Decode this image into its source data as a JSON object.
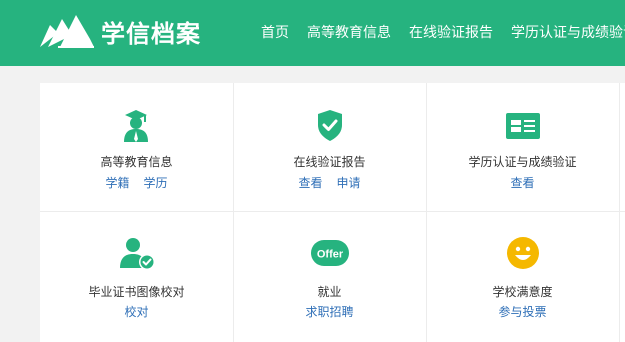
{
  "header": {
    "logo_text": "学信档案",
    "nav": [
      "首页",
      "高等教育信息",
      "在线验证报告",
      "学历认证与成绩验证"
    ]
  },
  "colors": {
    "brand_green": "#26b37f",
    "link_blue": "#2f6fb7",
    "smile_yellow": "#f5b800"
  },
  "services": [
    {
      "title": "高等教育信息",
      "icon": "graduate-icon",
      "links": [
        "学籍",
        "学历"
      ]
    },
    {
      "title": "在线验证报告",
      "icon": "shield-check-icon",
      "links": [
        "查看",
        "申请"
      ]
    },
    {
      "title": "学历认证与成绩验证",
      "icon": "id-card-icon",
      "links": [
        "查看"
      ]
    },
    {
      "title": "毕业证书图像校对",
      "icon": "user-check-icon",
      "links": [
        "校对"
      ]
    },
    {
      "title": "就业",
      "icon": "offer-icon",
      "icon_text": "Offer",
      "links": [
        "求职招聘"
      ]
    },
    {
      "title": "学校满意度",
      "icon": "smiley-icon",
      "links": [
        "参与投票"
      ]
    }
  ]
}
